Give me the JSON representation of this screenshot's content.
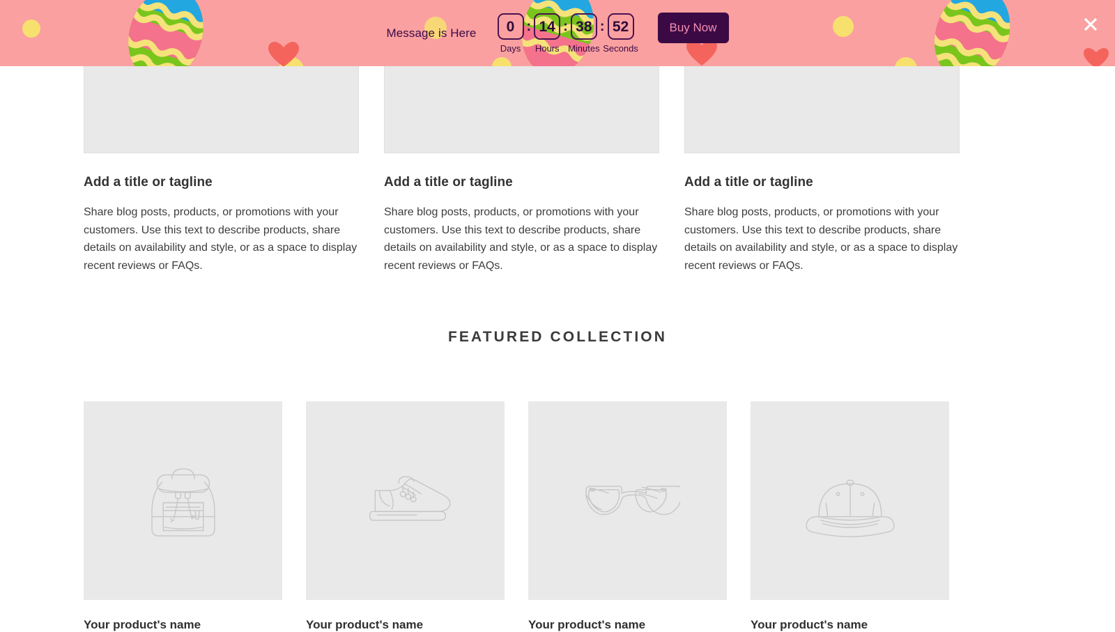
{
  "banner": {
    "message": "Message is Here",
    "countdown": [
      {
        "value": "0",
        "label": "Days"
      },
      {
        "value": "14",
        "label": "Hours"
      },
      {
        "value": "38",
        "label": "Minutes"
      },
      {
        "value": "52",
        "label": "Seconds"
      }
    ],
    "separator": ":",
    "cta_label": "Buy Now",
    "close_icon": "close-icon",
    "colors": {
      "background": "#faa0a0",
      "text": "#3b0a45",
      "cta_background": "#3b0a45",
      "cta_text": "#f48fb1",
      "egg_green": "#7ac51c",
      "egg_blue": "#22a7e0",
      "egg_pink": "#f4728c",
      "egg_yellow": "#f5e27a",
      "dot_yellow": "#f7e06e",
      "heart_red": "#f4645c"
    }
  },
  "multicolumn": {
    "columns": [
      {
        "title": "Add a title or tagline",
        "text": "Share blog posts, products, or promotions with your customers. Use this text to describe products, share details on availability and style, or as a space to display recent reviews or FAQs."
      },
      {
        "title": "Add a title or tagline",
        "text": "Share blog posts, products, or promotions with your customers. Use this text to describe products, share details on availability and style, or as a space to display recent reviews or FAQs."
      },
      {
        "title": "Add a title or tagline",
        "text": "Share blog posts, products, or promotions with your customers. Use this text to describe products, share details on availability and style, or as a space to display recent reviews or FAQs."
      }
    ]
  },
  "featured_collection": {
    "heading": "FEATURED COLLECTION",
    "products": [
      {
        "name": "Your product's name",
        "icon": "backpack-icon"
      },
      {
        "name": "Your product's name",
        "icon": "sneaker-icon"
      },
      {
        "name": "Your product's name",
        "icon": "eyeglasses-icon"
      },
      {
        "name": "Your product's name",
        "icon": "baseball-cap-icon"
      }
    ]
  }
}
